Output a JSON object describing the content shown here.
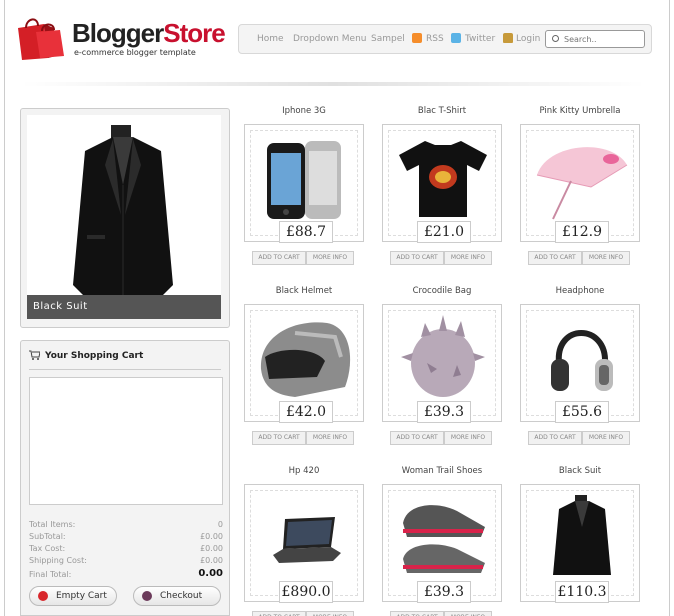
{
  "header": {
    "logo_blogger": "Blogger",
    "logo_store": "Store",
    "tagline": "e-commerce blogger template"
  },
  "nav": {
    "items": [
      "Home",
      "Dropdown Menu",
      "Sampel",
      "RSS",
      "Twitter",
      "Login"
    ],
    "search_placeholder": "Search.."
  },
  "featured": {
    "caption": "Black Suit",
    "image": "suit-image"
  },
  "cart": {
    "title": "Your Shopping Cart",
    "rows": [
      {
        "label": "Total Items:",
        "value": "0"
      },
      {
        "label": "SubTotal:",
        "value": "£0.00"
      },
      {
        "label": "Tax Cost:",
        "value": "£0.00"
      },
      {
        "label": "Shipping Cost:",
        "value": "£0.00"
      },
      {
        "label": "Final Total:",
        "value": "0.00"
      }
    ],
    "empty_button": "Empty Cart",
    "checkout_button": "Checkout"
  },
  "products": [
    {
      "name": "Iphone 3G",
      "price": "£88.7",
      "image": "iphone-image"
    },
    {
      "name": "Blac T-Shirt",
      "price": "£21.0",
      "image": "tshirt-image"
    },
    {
      "name": "Pink Kitty Umbrella",
      "price": "£12.9",
      "image": "umbrella-image"
    },
    {
      "name": "Black Helmet",
      "price": "£42.0",
      "image": "helmet-image"
    },
    {
      "name": "Crocodile Bag",
      "price": "£39.3",
      "image": "bag-image"
    },
    {
      "name": "Headphone",
      "price": "£55.6",
      "image": "headphone-image"
    },
    {
      "name": "Hp 420",
      "price": "£890.0",
      "image": "laptop-image"
    },
    {
      "name": "Woman Trail Shoes",
      "price": "£39.3",
      "image": "shoes-image"
    },
    {
      "name": "Black Suit",
      "price": "£110.3",
      "image": "suit-image"
    }
  ],
  "product_buttons": {
    "add": "ADD TO CART",
    "more": "MORE INFO"
  }
}
